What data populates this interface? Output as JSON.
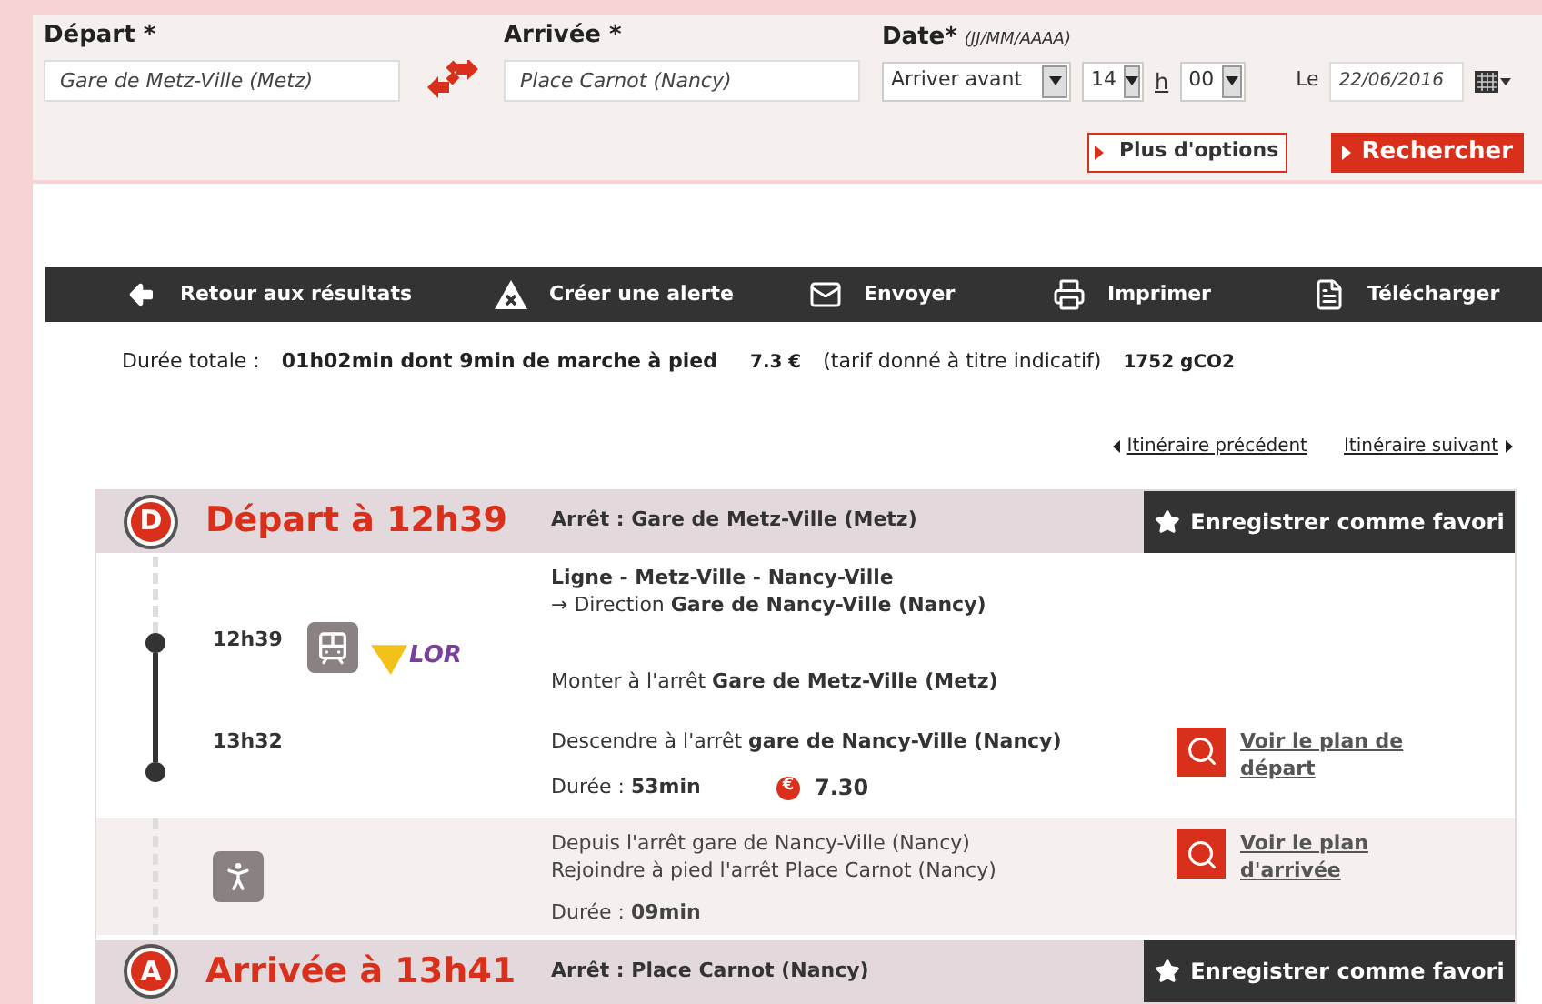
{
  "search_form": {
    "fields": [
      {
        "label": "Départ *",
        "value": "Gare de Metz-Ville (Metz)"
      },
      {
        "label": "Arrivée *",
        "value": "Place Carnot (Nancy)"
      }
    ],
    "date": {
      "label": "Date*",
      "format": "(JJ/MM/AAAA)",
      "mode": "Arriver avant",
      "hour": "14",
      "hour_unit": "h",
      "minute": "00",
      "date_label": "Le",
      "date": "22/06/2016"
    },
    "buttons": [
      {
        "label": "Plus d'options",
        "kind": "outline"
      },
      {
        "label": "Rechercher",
        "kind": "primary"
      }
    ]
  },
  "toolbar": [
    {
      "label": "Retour aux résultats",
      "kind": "back"
    },
    {
      "label": "Créer une alerte",
      "kind": "alert"
    },
    {
      "label": "Envoyer",
      "kind": "mail"
    },
    {
      "label": "Imprimer",
      "kind": "print"
    },
    {
      "label": "Télécharger",
      "kind": "pdf"
    }
  ],
  "summary": {
    "label": "Durée totale :",
    "duration": "01h02min dont 9min de marche à pied",
    "price": "7.3 €",
    "note": "(tarif donné à titre indicatif)",
    "co2": "1752 gCO2"
  },
  "navigation": {
    "previous": "Itinéraire précédent",
    "next": "Itinéraire suivant"
  },
  "itinerary": {
    "departure": {
      "badge": "D",
      "title": "Départ à 12h39",
      "stop": "Arrêt : Gare de Metz-Ville (Metz)",
      "favorite": "Enregistrer comme favori"
    },
    "legs": [
      {
        "kind": "train",
        "line": "Ligne - Metz-Ville - Nancy-Ville",
        "direction": "→ Direction **Gare de Nancy-Ville (Nancy)**",
        "start_time": "12h39",
        "logo": "LOR",
        "board": "Monter à l'arrêt **Gare de Metz-Ville (Metz)**",
        "end_time": "13h32",
        "alight": "Descendre à l'arrêt **gare de Nancy-Ville (Nancy)**",
        "duration": "Durée : **53min**",
        "fare_symbol": "€",
        "fare": "7.30",
        "map_link": "Voir le plan de départ"
      },
      {
        "kind": "walk",
        "from": "Depuis l'arrêt gare de Nancy-Ville (Nancy)",
        "to": "Rejoindre à pied l'arrêt Place Carnot (Nancy)",
        "duration": "Durée : **09min**",
        "map_link": "Voir le plan d'arrivée"
      }
    ],
    "arrival": {
      "badge": "A",
      "title": "Arrivée à 13h41",
      "stop": "Arrêt : Place Carnot (Nancy)",
      "favorite": "Enregistrer comme favori"
    }
  }
}
